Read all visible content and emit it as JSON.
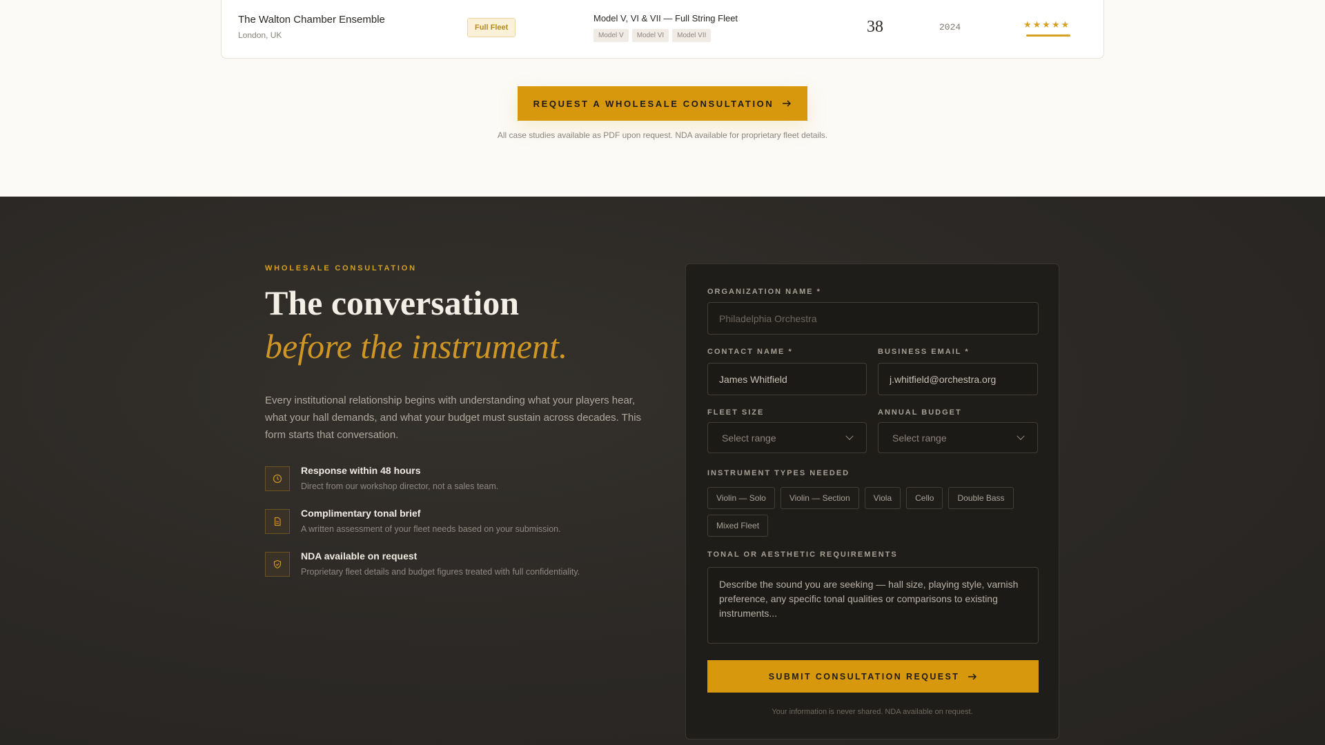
{
  "case_study": {
    "org_name": "The Walton Chamber Ensemble",
    "location": "London, UK",
    "badge": "Full Fleet",
    "models_title": "Model V, VI & VII — Full String Fleet",
    "model_tags": [
      "Model V",
      "Model VI",
      "Model VII"
    ],
    "count": "38",
    "year": "2024",
    "rating": "★★★★★"
  },
  "cta": {
    "label": "REQUEST A WHOLESALE CONSULTATION",
    "note": "All case studies available as PDF upon request. NDA available for proprietary fleet details."
  },
  "consultation": {
    "eyebrow": "WHOLESALE CONSULTATION",
    "heading": "The conversation",
    "heading_italic": "before the instrument.",
    "intro": "Every institutional relationship begins with understanding what your players hear, what your hall demands, and what your budget must sustain across decades. This form starts that conversation.",
    "features": [
      {
        "title": "Response within 48 hours",
        "desc": "Direct from our workshop director, not a sales team."
      },
      {
        "title": "Complimentary tonal brief",
        "desc": "A written assessment of your fleet needs based on your submission."
      },
      {
        "title": "NDA available on request",
        "desc": "Proprietary fleet details and budget figures treated with full confidentiality."
      }
    ]
  },
  "form": {
    "org_label": "ORGANIZATION NAME *",
    "org_placeholder": "Philadelphia Orchestra",
    "contact_label": "CONTACT NAME *",
    "contact_value": "James Whitfield",
    "email_label": "BUSINESS EMAIL *",
    "email_value": "j.whitfield@orchestra.org",
    "fleet_label": "FLEET SIZE",
    "fleet_value": "Select range",
    "budget_label": "ANNUAL BUDGET",
    "budget_value": "Select range",
    "types_label": "INSTRUMENT TYPES NEEDED",
    "types": [
      "Violin — Solo",
      "Violin — Section",
      "Viola",
      "Cello",
      "Double Bass",
      "Mixed Fleet"
    ],
    "tonal_label": "TONAL OR AESTHETIC REQUIREMENTS",
    "tonal_placeholder": "Describe the sound you are seeking — hall size, playing style, varnish preference, any specific tonal qualities or comparisons to existing instruments...",
    "submit_label": "SUBMIT CONSULTATION REQUEST",
    "note": "Your information is never shared. NDA available on request."
  },
  "colors": {
    "accent": "#d8980e",
    "dark_bg": "#2b2825",
    "light_bg": "#fbfaf6"
  }
}
